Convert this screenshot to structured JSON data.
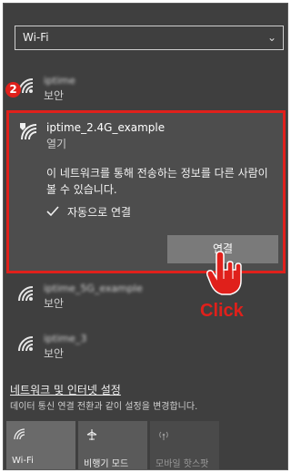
{
  "dropdown": {
    "value": "Wi-Fi"
  },
  "networks": [
    {
      "name": "iptime",
      "state": "보안"
    },
    {
      "name": "iptime_5G_example",
      "state": "보안"
    },
    {
      "name": "iptime_3",
      "state": "보안"
    }
  ],
  "expanded": {
    "name": "iptime_2.4G_example",
    "state": "열기",
    "warning": "이 네트워크를 통해 전송하는 정보를 다른 사람이 볼 수 있습니다.",
    "auto_connect": {
      "label": "자동으로 연결",
      "checked": true
    },
    "connect_label": "연결"
  },
  "annotation": {
    "step": "2",
    "click_label": "Click",
    "color": "#e0201b"
  },
  "footer": {
    "settings_link": "네트워크 및 인터넷 설정",
    "settings_desc": "데이터 통신 연결 전환과 같이 설정을 변경합니다."
  },
  "tiles": [
    {
      "label": "Wi-Fi",
      "icon": "wifi-icon",
      "state": "on"
    },
    {
      "label": "비행기 모드",
      "icon": "airplane-icon",
      "state": "off"
    },
    {
      "label": "모바일 핫스팟",
      "icon": "hotspot-icon",
      "state": "disabled"
    }
  ]
}
